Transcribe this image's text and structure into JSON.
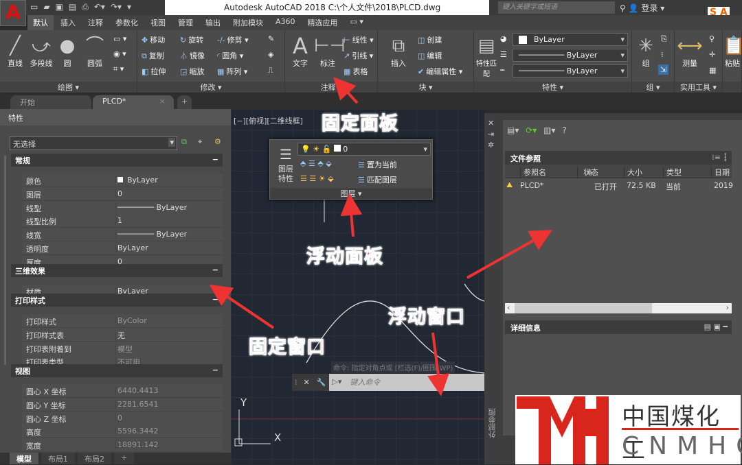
{
  "titlebar": {
    "app_icon": "A",
    "title": "Autodesk AutoCAD 2018    C:\\个人文件\\2018\\PLCD.dwg",
    "search_placeholder": "键入关键字或短语",
    "login": "登录"
  },
  "ribbon_tabs": [
    "默认",
    "插入",
    "注释",
    "参数化",
    "视图",
    "管理",
    "输出",
    "附加模块",
    "A360",
    "精选应用"
  ],
  "ribbon": {
    "draw": {
      "title": "绘图",
      "line": "直线",
      "polyline": "多段线",
      "circle": "圆",
      "arc": "圆弧"
    },
    "modify": {
      "title": "修改",
      "move": "移动",
      "rotate": "旋转",
      "trim": "修剪",
      "copy": "复制",
      "mirror": "镜像",
      "fillet": "圆角",
      "stretch": "拉伸",
      "scale": "缩放",
      "array": "阵列"
    },
    "annotation": {
      "title": "注释",
      "text": "文字",
      "dimension": "标注",
      "linear": "线性",
      "leader": "引线",
      "table": "表格"
    },
    "block": {
      "title": "块",
      "insert": "插入",
      "create": "创建",
      "edit": "编辑",
      "edit_attr": "编辑属性"
    },
    "properties": {
      "title": "特性",
      "match": "特性匹配",
      "color": "ByLayer",
      "linetype": "ByLayer",
      "lineweight": "ByLayer"
    },
    "group": {
      "title": "组",
      "group": "组"
    },
    "utilities": {
      "title": "实用工具",
      "measure": "测量"
    },
    "clipboard": {
      "paste": "粘贴"
    }
  },
  "doc_tabs": {
    "start": "开始",
    "drawing": "PLCD*"
  },
  "props": {
    "title": "特性",
    "selection": "无选择",
    "sections": {
      "general": "常规",
      "3d": "三维效果",
      "plot": "打印样式",
      "view": "视图"
    },
    "general": [
      {
        "k": "颜色",
        "v": "ByLayer"
      },
      {
        "k": "图层",
        "v": "0"
      },
      {
        "k": "线型",
        "v": "ByLayer"
      },
      {
        "k": "线型比例",
        "v": "1"
      },
      {
        "k": "线宽",
        "v": "ByLayer"
      },
      {
        "k": "透明度",
        "v": "ByLayer"
      },
      {
        "k": "厚度",
        "v": "0"
      }
    ],
    "3d": [
      {
        "k": "材质",
        "v": "ByLayer"
      }
    ],
    "plot": [
      {
        "k": "打印样式",
        "v": "ByColor"
      },
      {
        "k": "打印样式表",
        "v": "无"
      },
      {
        "k": "打印表附着到",
        "v": "模型"
      },
      {
        "k": "打印表类型",
        "v": "不可用"
      }
    ],
    "view": [
      {
        "k": "圆心 X 坐标",
        "v": "6440.4413"
      },
      {
        "k": "圆心 Y 坐标",
        "v": "2281.6541"
      },
      {
        "k": "圆心 Z 坐标",
        "v": "0"
      },
      {
        "k": "高度",
        "v": "5596.3442"
      },
      {
        "k": "宽度",
        "v": "18891.142"
      }
    ]
  },
  "layout_tabs": [
    "模型",
    "布局1",
    "布局2"
  ],
  "canvas": {
    "view_label": "[−][俯视][二维线框]",
    "cmd_history": "命令: 指定对角点或 [栏选(F)/圈围(WP)",
    "cmd_placeholder": "键入命令"
  },
  "layer_panel": {
    "layer": "0",
    "props": "图层特性",
    "set_current": "置为当前",
    "match": "匹配图层",
    "title": "图层"
  },
  "xref": {
    "section": "文件参照",
    "columns": [
      "参照名",
      "状态",
      "大小",
      "类型",
      "日期"
    ],
    "rows": [
      {
        "name": "PLCD*",
        "status": "已打开",
        "size": "72.5 KB",
        "type": "当前",
        "date": "2019"
      }
    ],
    "details": "详细信息",
    "side_label": "外部参照"
  },
  "annotations": {
    "fixed_panel": "固定面板",
    "floating_panel": "浮动面板",
    "fixed_window": "固定窗口",
    "floating_window": "浮动窗口"
  },
  "logo": {
    "cn": "中国煤化工",
    "en": "CNMHG"
  }
}
